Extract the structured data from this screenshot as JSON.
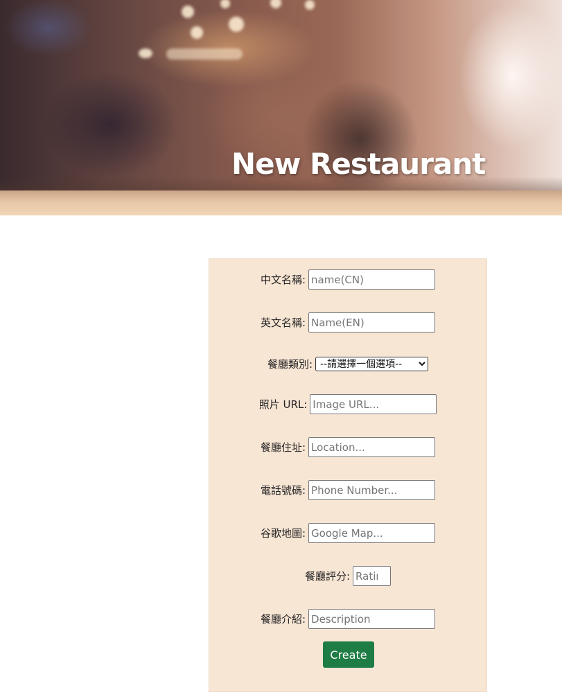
{
  "header": {
    "title": "New Restaurant"
  },
  "form": {
    "fields": [
      {
        "label": "中文名稱:",
        "placeholder": "name(CN)"
      },
      {
        "label": "英文名稱:",
        "placeholder": "Name(EN)"
      },
      {
        "label": "餐廳類別:",
        "select_value": "--請選擇一個選項--"
      },
      {
        "label": "照片 URL:",
        "placeholder": "Image URL..."
      },
      {
        "label": "餐廳住址:",
        "placeholder": "Location..."
      },
      {
        "label": "電話號碼:",
        "placeholder": "Phone Number..."
      },
      {
        "label": "谷歌地圖:",
        "placeholder": "Google Map..."
      },
      {
        "label": "餐廳評分:",
        "placeholder": "Rating"
      },
      {
        "label": "餐廳介紹:",
        "placeholder": "Description"
      }
    ],
    "submit_label": "Create"
  },
  "colors": {
    "form_background": "#f8e6d5",
    "button_background": "#1e7d45",
    "title_text": "#ffffff"
  }
}
